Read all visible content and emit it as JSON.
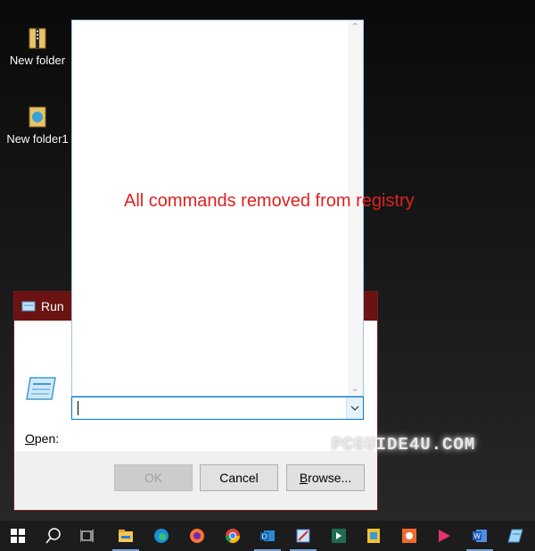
{
  "desktop": {
    "icons": [
      {
        "label": "New folder"
      },
      {
        "label": "New folder1"
      }
    ]
  },
  "run_dialog": {
    "title": "Run",
    "open_label_access": "O",
    "open_label_rest": "pen:",
    "input_value": "",
    "buttons": {
      "ok": "OK",
      "cancel": "Cancel",
      "browse_access": "B",
      "browse_rest": "rowse..."
    }
  },
  "dropdown": {
    "annotation": "All commands removed from registry"
  },
  "watermark": "PCGUIDE4U.COM",
  "taskbar": {
    "items": [
      "start-icon",
      "search-icon",
      "task-view-icon",
      "file-explorer-icon",
      "edge-icon",
      "firefox-icon",
      "chrome-icon",
      "outlook-icon",
      "snipping-tool-icon",
      "app-icon",
      "notes-icon",
      "photo-app-icon",
      "media-player-icon",
      "word-icon",
      "app-icon-2"
    ]
  },
  "colors": {
    "accent": "#0078d7",
    "title_bar": "#6b1212",
    "annotation": "#e02020"
  }
}
